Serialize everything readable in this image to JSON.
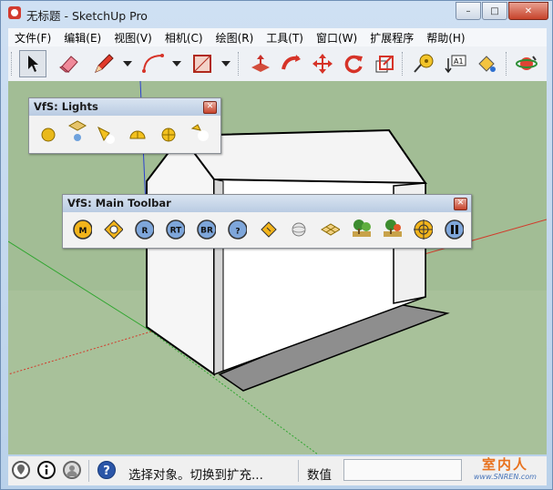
{
  "window": {
    "title": "无标题 - SketchUp Pro",
    "controls": {
      "minimize": "–",
      "maximize": "□",
      "close": "✕"
    }
  },
  "menu": [
    "文件(F)",
    "编辑(E)",
    "视图(V)",
    "相机(C)",
    "绘图(R)",
    "工具(T)",
    "窗口(W)",
    "扩展程序",
    "帮助(H)"
  ],
  "toolbar": {
    "tools": [
      "select-arrow-icon",
      "eraser-icon",
      "pencil-icon",
      "arc-icon",
      "rectangle-icon",
      "push-pull-icon",
      "follow-me-icon",
      "move-icon",
      "rotate-icon",
      "scale-icon",
      "tape-measure-icon",
      "text-icon",
      "paint-bucket-icon",
      "orbit-icon"
    ],
    "selected": "select-arrow-icon",
    "text_icon_label": "A1"
  },
  "palettes": {
    "lights": {
      "title": "VfS: Lights",
      "icons": [
        "omni-light-icon",
        "spot-light-icon",
        "cone-light-icon",
        "dome-light-icon",
        "sphere-light-icon",
        "light-settings-icon"
      ]
    },
    "main": {
      "title": "VfS: Main Toolbar",
      "buttons": [
        {
          "icon": "metric-icon",
          "label": "M"
        },
        {
          "icon": "material-tag-icon",
          "label": ""
        },
        {
          "icon": "render-icon",
          "label": "R"
        },
        {
          "icon": "render-region-icon",
          "label": "RT"
        },
        {
          "icon": "batch-render-icon",
          "label": "BR"
        },
        {
          "icon": "help-icon",
          "label": "?"
        },
        {
          "icon": "tag-icon",
          "label": ""
        },
        {
          "icon": "sphere-preview-icon",
          "label": ""
        },
        {
          "icon": "plane-icon",
          "label": ""
        },
        {
          "icon": "tree-landscape-icon",
          "label": ""
        },
        {
          "icon": "tree-landscape-2-icon",
          "label": ""
        },
        {
          "icon": "target-icon",
          "label": ""
        },
        {
          "icon": "pause-icon",
          "label": ""
        }
      ]
    }
  },
  "status": {
    "hint": "选择对象。切换到扩充...",
    "measurement_label": "数值",
    "measurement_value": ""
  },
  "watermark": {
    "line1": "室内人",
    "line2": "www.SNREN.com"
  },
  "colors": {
    "viewport_bg": "#a2bd95",
    "axis_red": "#d23a2a",
    "axis_green": "#2fa62f",
    "axis_blue": "#2a3fd1"
  }
}
